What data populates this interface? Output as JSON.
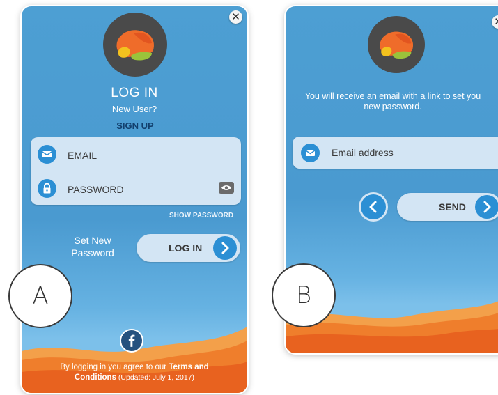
{
  "panel_a": {
    "title": "LOG IN",
    "new_user": "New User?",
    "sign_up": "SIGN UP",
    "email_label": "EMAIL",
    "password_label": "PASSWORD",
    "show_password": "SHOW PASSWORD",
    "set_new_password_line1": "Set New",
    "set_new_password_line2": "Password",
    "login_button": "LOG IN",
    "close": "✕",
    "terms_line1_prefix": "By logging in you agree to our ",
    "terms_line1_link": "Terms and",
    "terms_line2_link": "Conditions",
    "terms_line2_suffix": " (Updated: July 1, 2017)",
    "facebook_glyph": "f",
    "figure_label": "A"
  },
  "panel_b": {
    "message_line1": "You will receive an email with a link to set you",
    "message_line2": "new password.",
    "email_placeholder": "Email address",
    "send_button": "SEND",
    "close": "✕",
    "figure_label": "B"
  },
  "colors": {
    "background_blue": "#4d9fd3",
    "accent_blue": "#2b8fd4",
    "field_bg": "#d3e5f4",
    "wave_orange": "#f07a2a",
    "logo_orange": "#ef6c2a",
    "logo_yellow": "#f3c21e",
    "logo_green": "#9ac33b",
    "facebook_blue": "#26527f"
  },
  "icons": {
    "email": "envelope-icon",
    "password": "lock-icon",
    "show_password": "eye-icon",
    "next": "chevron-right-icon",
    "back": "chevron-left-icon",
    "close": "close-icon",
    "facebook": "facebook-icon"
  }
}
